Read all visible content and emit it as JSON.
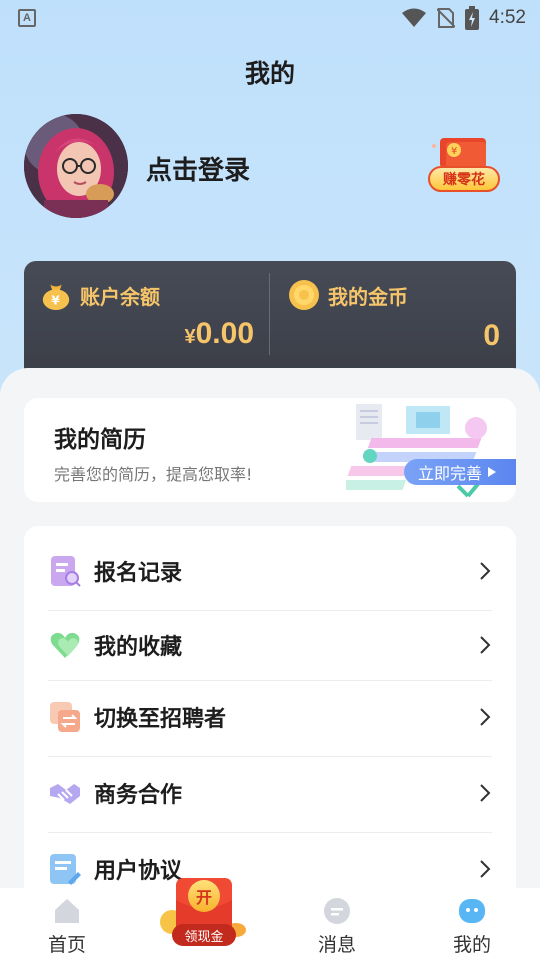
{
  "status_bar": {
    "time": "4:52",
    "notif_letter": "A"
  },
  "header": {
    "title": "我的"
  },
  "profile": {
    "login_text": "点击登录",
    "earn_label": "赚零花"
  },
  "balance": {
    "account_label": "账户余额",
    "account_currency": "¥",
    "account_value": "0.00",
    "coins_label": "我的金币",
    "coins_value": "0",
    "accent_color": "#f6c56a"
  },
  "resume": {
    "title": "我的简历",
    "subtitle": "完善您的简历，提高您取率!",
    "button": "立即完善"
  },
  "menu": {
    "items": [
      {
        "label": "报名记录",
        "icon": "document-search-icon"
      },
      {
        "label": "我的收藏",
        "icon": "heart-icon"
      },
      {
        "label": "切换至招聘者",
        "icon": "switch-icon"
      },
      {
        "label": "商务合作",
        "icon": "handshake-icon"
      },
      {
        "label": "用户协议",
        "icon": "agreement-icon"
      }
    ]
  },
  "bottom_nav": {
    "home": "首页",
    "cash_badge": "领现金",
    "cash_open": "开",
    "messages": "消息",
    "mine": "我的"
  }
}
